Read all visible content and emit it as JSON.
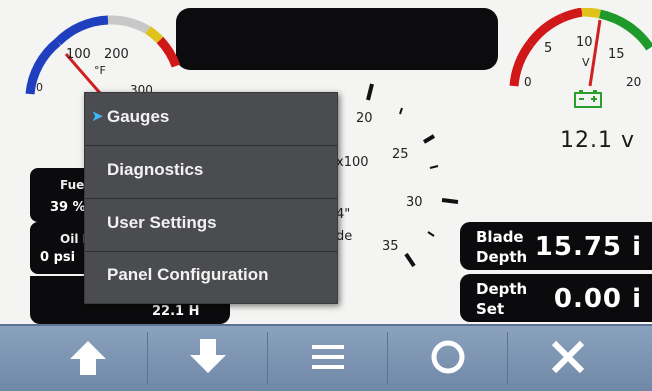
{
  "temp_gauge": {
    "ticks": [
      "0",
      "100",
      "200",
      "300"
    ],
    "unit": "°F"
  },
  "volt_gauge": {
    "ticks": [
      "0",
      "5",
      "10",
      "15",
      "20"
    ],
    "unit": "V"
  },
  "voltage": {
    "value": "12.1 v"
  },
  "tach": {
    "ticks": [
      "20",
      "25",
      "30",
      "35"
    ],
    "multiplier": "x100"
  },
  "tach_partial": {
    "inch": "4\"",
    "blade": "de"
  },
  "readouts": {
    "fuel": {
      "label": "Fue",
      "value": "39 %"
    },
    "oil": {
      "label": "Oil P",
      "value": "0 psi"
    },
    "hours": "22.1 H"
  },
  "right_panel": {
    "blade_depth": {
      "line1": "Blade",
      "line2": "Depth",
      "value": "15.75 i"
    },
    "depth_set": {
      "line1": "Depth",
      "line2": "Set",
      "value": "0.00 i"
    }
  },
  "menu": {
    "items": [
      {
        "label": "Gauges",
        "selected": true
      },
      {
        "label": "Diagnostics"
      },
      {
        "label": "User Settings"
      },
      {
        "label": "Panel Configuration"
      }
    ]
  },
  "navbar": {
    "buttons": [
      {
        "icon": "up-arrow-icon"
      },
      {
        "icon": "down-arrow-icon"
      },
      {
        "icon": "menu-icon"
      },
      {
        "icon": "circle-icon"
      },
      {
        "icon": "close-icon"
      }
    ]
  },
  "colors": {
    "accent_selected": "#3fb6ff",
    "navbar": "#7b94b3",
    "menu_bg": "#4b4c4f"
  }
}
